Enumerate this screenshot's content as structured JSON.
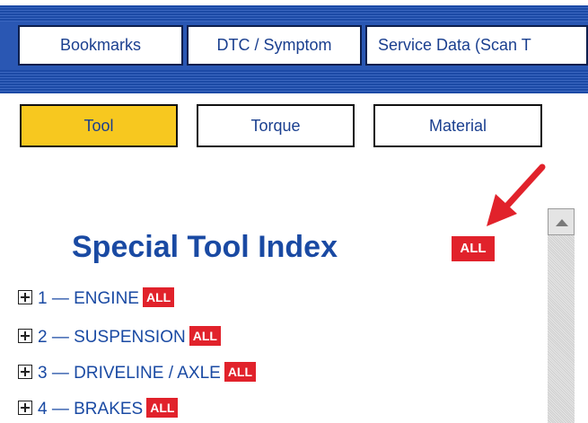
{
  "top_tabs": [
    {
      "label": "Bookmarks"
    },
    {
      "label": "DTC / Symptom"
    },
    {
      "label": "Service Data (Scan T"
    }
  ],
  "sub_tabs": [
    {
      "label": "Tool",
      "active": true
    },
    {
      "label": "Torque",
      "active": false
    },
    {
      "label": "Material",
      "active": false
    }
  ],
  "title": {
    "text": "Special Tool Index",
    "badge": "ALL"
  },
  "tree_items": [
    {
      "label": "1 — ENGINE",
      "badge": "ALL"
    },
    {
      "label": "2 — SUSPENSION",
      "badge": "ALL"
    },
    {
      "label": "3 — DRIVELINE / AXLE",
      "badge": "ALL"
    },
    {
      "label": "4 — BRAKES",
      "badge": "ALL"
    }
  ],
  "colors": {
    "accent_blue": "#1a4aa3",
    "active_tab": "#f7c81f",
    "badge_red": "#e1222b",
    "arrow_red": "#e1222b"
  },
  "icons": {
    "expand": "plus-box-icon",
    "scroll_up": "scroll-up-arrow-icon",
    "callout": "red-arrow-icon"
  }
}
